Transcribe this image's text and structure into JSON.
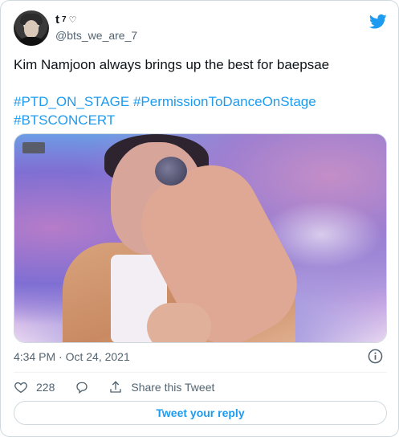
{
  "author": {
    "display_name": "t",
    "display_name_sup": "7",
    "display_name_suffix": "♡",
    "handle": "@bts_we_are_7"
  },
  "tweet": {
    "text_line": "Kim Namjoon always brings up the best for baepsae",
    "hashtags_line1": "#PTD_ON_STAGE #PermissionToDanceOnStage",
    "hashtags_line2": "#BTSCONCERT",
    "timestamp": "4:34 PM · Oct 24, 2021"
  },
  "actions": {
    "like_count": "228",
    "share_label": "Share this Tweet"
  },
  "reply_button_label": "Tweet your reply",
  "colors": {
    "accent": "#1d9bf0",
    "text": "#0f1419",
    "muted": "#536471",
    "border": "#cfd9de"
  },
  "icons": [
    "twitter-bird-icon",
    "info-icon",
    "heart-icon",
    "reply-icon",
    "share-icon"
  ]
}
